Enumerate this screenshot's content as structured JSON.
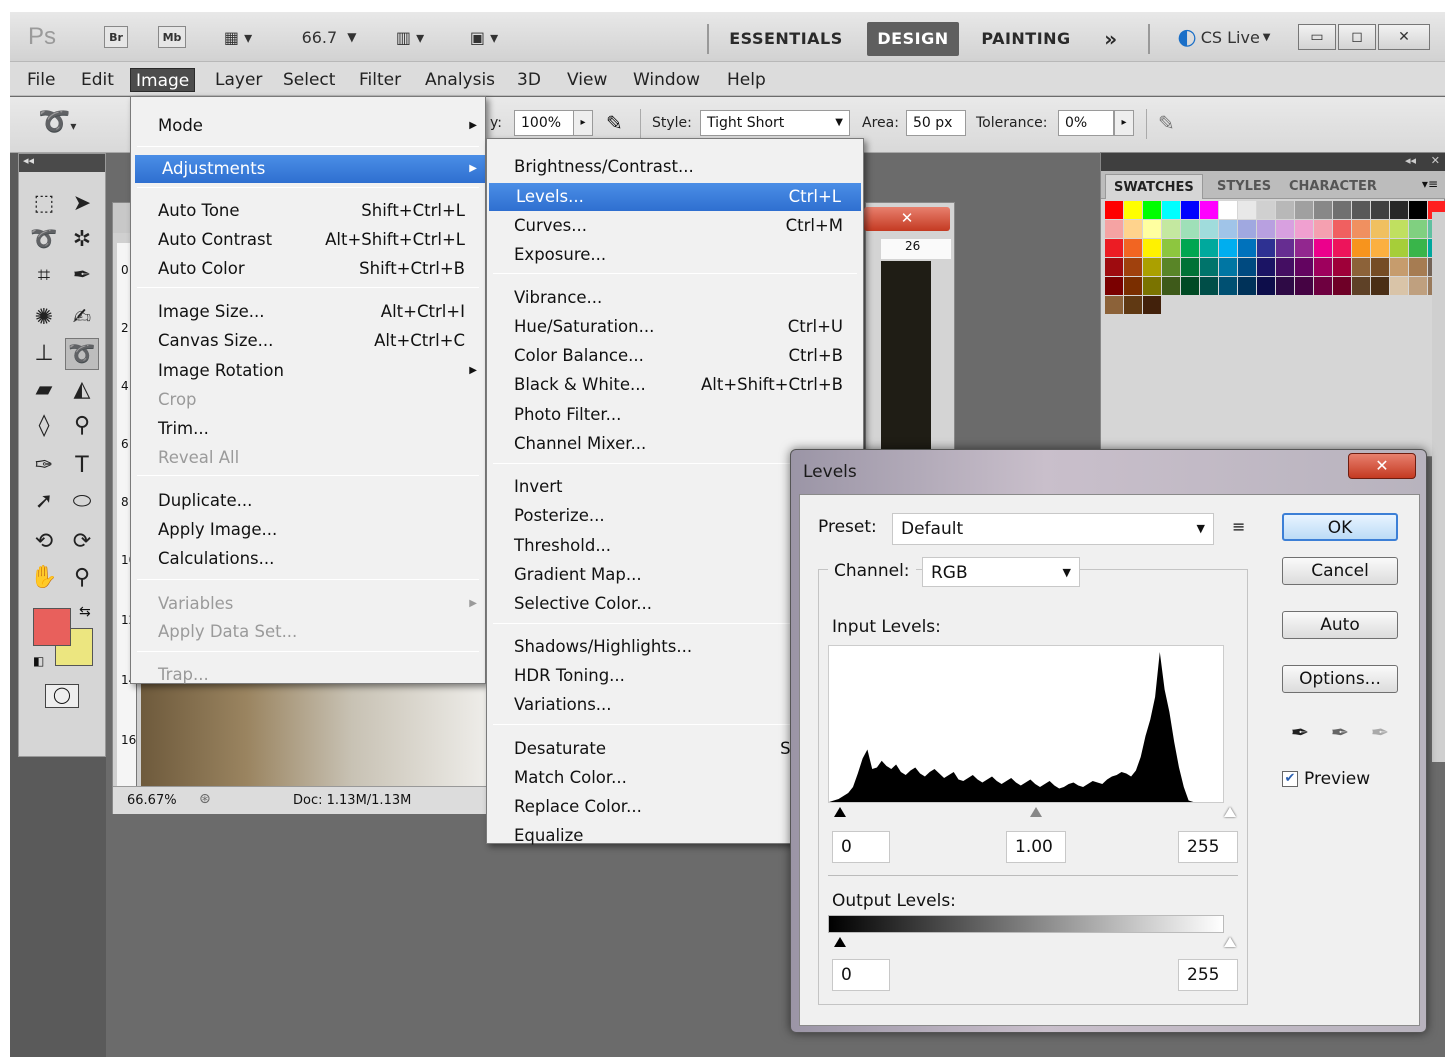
{
  "appbar": {
    "logo": "Ps",
    "bridge": "Br",
    "minibridge": "Mb",
    "zoom": "66.7",
    "workspaces": [
      "ESSENTIALS",
      "DESIGN",
      "PAINTING"
    ],
    "overflow": "»",
    "cslive": "CS Live"
  },
  "menubar": [
    "File",
    "Edit",
    "Image",
    "Layer",
    "Select",
    "Filter",
    "Analysis",
    "3D",
    "View",
    "Window",
    "Help"
  ],
  "options": {
    "opacity_suffix": "y:",
    "opacity_value": "100%",
    "style_label": "Style:",
    "style_value": "Tight Short",
    "area_label": "Area:",
    "area_value": "50 px",
    "tolerance_label": "Tolerance:",
    "tolerance_value": "0%"
  },
  "image_menu": [
    {
      "label": "Mode",
      "shortcut": "",
      "submenu": true,
      "disabled": false
    },
    {
      "label": "Adjustments",
      "shortcut": "",
      "submenu": true,
      "disabled": false
    },
    {
      "label": "Auto Tone",
      "shortcut": "Shift+Ctrl+L"
    },
    {
      "label": "Auto Contrast",
      "shortcut": "Alt+Shift+Ctrl+L"
    },
    {
      "label": "Auto Color",
      "shortcut": "Shift+Ctrl+B"
    },
    {
      "label": "Image Size...",
      "shortcut": "Alt+Ctrl+I"
    },
    {
      "label": "Canvas Size...",
      "shortcut": "Alt+Ctrl+C"
    },
    {
      "label": "Image Rotation",
      "shortcut": "",
      "submenu": true
    },
    {
      "label": "Crop",
      "shortcut": "",
      "disabled": true
    },
    {
      "label": "Trim...",
      "shortcut": ""
    },
    {
      "label": "Reveal All",
      "shortcut": "",
      "disabled": true
    },
    {
      "label": "Duplicate...",
      "shortcut": ""
    },
    {
      "label": "Apply Image...",
      "shortcut": ""
    },
    {
      "label": "Calculations...",
      "shortcut": ""
    },
    {
      "label": "Variables",
      "shortcut": "",
      "submenu": true,
      "disabled": true
    },
    {
      "label": "Apply Data Set...",
      "shortcut": "",
      "disabled": true
    },
    {
      "label": "Trap...",
      "shortcut": "",
      "disabled": true
    }
  ],
  "adjustments_menu": [
    {
      "label": "Brightness/Contrast...",
      "shortcut": ""
    },
    {
      "label": "Levels...",
      "shortcut": "Ctrl+L"
    },
    {
      "label": "Curves...",
      "shortcut": "Ctrl+M"
    },
    {
      "label": "Exposure...",
      "shortcut": ""
    },
    {
      "label": "Vibrance...",
      "shortcut": ""
    },
    {
      "label": "Hue/Saturation...",
      "shortcut": "Ctrl+U"
    },
    {
      "label": "Color Balance...",
      "shortcut": "Ctrl+B"
    },
    {
      "label": "Black & White...",
      "shortcut": "Alt+Shift+Ctrl+B"
    },
    {
      "label": "Photo Filter...",
      "shortcut": ""
    },
    {
      "label": "Channel Mixer...",
      "shortcut": ""
    },
    {
      "label": "Invert",
      "shortcut": ""
    },
    {
      "label": "Posterize...",
      "shortcut": ""
    },
    {
      "label": "Threshold...",
      "shortcut": ""
    },
    {
      "label": "Gradient Map...",
      "shortcut": ""
    },
    {
      "label": "Selective Color...",
      "shortcut": ""
    },
    {
      "label": "Shadows/Highlights...",
      "shortcut": ""
    },
    {
      "label": "HDR Toning...",
      "shortcut": ""
    },
    {
      "label": "Variations...",
      "shortcut": ""
    },
    {
      "label": "Desaturate",
      "shortcut": "Shift+C"
    },
    {
      "label": "Match Color...",
      "shortcut": ""
    },
    {
      "label": "Replace Color...",
      "shortcut": ""
    },
    {
      "label": "Equalize",
      "shortcut": ""
    }
  ],
  "document": {
    "zoom": "66.67%",
    "doc_info": "Doc: 1.13M/1.13M",
    "ruler_marks": [
      "0",
      "2",
      "4",
      "6",
      "8",
      "10",
      "12",
      "14",
      "16"
    ],
    "ruler2": "26"
  },
  "swatches": {
    "tabs": [
      "SWATCHES",
      "STYLES",
      "CHARACTER"
    ],
    "colors": [
      "#ff0000",
      "#ffff00",
      "#00ff00",
      "#00ffff",
      "#0000ff",
      "#ff00ff",
      "#ffffff",
      "#e8e8e8",
      "#d0d0d0",
      "#b8b8b8",
      "#a0a0a0",
      "#888888",
      "#707070",
      "#585858",
      "#404040",
      "#282828",
      "#000000",
      "#ff2020",
      "#f5a3a3",
      "#ffd38d",
      "#ffffa0",
      "#c4e8a0",
      "#9fe0b8",
      "#a0dcdc",
      "#a0c4e8",
      "#a0a8e0",
      "#b8a0e0",
      "#d8a0e0",
      "#f0a0d0",
      "#f5a0b0",
      "#f06060",
      "#f09060",
      "#f0c060",
      "#c0e060",
      "#80d080",
      "#60c0a0",
      "#ec1c24",
      "#f26522",
      "#fff200",
      "#8dc63f",
      "#00a651",
      "#00a99d",
      "#00aeef",
      "#0072bc",
      "#2e3192",
      "#662d91",
      "#92278f",
      "#ec008c",
      "#ed145b",
      "#f7941d",
      "#fbb040",
      "#a6ce39",
      "#39b54a",
      "#00a79d",
      "#9e0b0f",
      "#a0410d",
      "#aba000",
      "#598527",
      "#007236",
      "#00746b",
      "#0076a3",
      "#004a80",
      "#1b1464",
      "#440e62",
      "#630460",
      "#9e005d",
      "#9e0039",
      "#8c6239",
      "#754c24",
      "#c69c6d",
      "#a67c52",
      "#736357",
      "#7a0000",
      "#7a2e00",
      "#7a7300",
      "#3e5a1a",
      "#004a24",
      "#004e48",
      "#005072",
      "#003259",
      "#0d0d4a",
      "#2e0a45",
      "#450343",
      "#6e0040",
      "#6e0027",
      "#5e4127",
      "#4a2f16",
      "#d9c4a8",
      "#bfa07f",
      "#997a5c",
      "#8c6239",
      "#603913",
      "#42210b"
    ]
  },
  "levels": {
    "title": "Levels",
    "preset_label": "Preset:",
    "preset_value": "Default",
    "channel_label": "Channel:",
    "channel_value": "RGB",
    "input_label": "Input Levels:",
    "input_black": "0",
    "input_mid": "1.00",
    "input_white": "255",
    "output_label": "Output Levels:",
    "output_black": "0",
    "output_white": "255",
    "buttons": {
      "ok": "OK",
      "cancel": "Cancel",
      "auto": "Auto",
      "options": "Options..."
    },
    "preview_label": "Preview",
    "preview_checked": true,
    "histogram": [
      0,
      2,
      4,
      8,
      12,
      20,
      38,
      58,
      70,
      44,
      46,
      55,
      48,
      44,
      50,
      40,
      36,
      42,
      46,
      38,
      34,
      40,
      44,
      38,
      32,
      36,
      40,
      30,
      28,
      32,
      36,
      30,
      26,
      30,
      34,
      28,
      24,
      28,
      32,
      26,
      22,
      26,
      30,
      24,
      20,
      24,
      28,
      22,
      18,
      20,
      24,
      26,
      22,
      20,
      24,
      28,
      26,
      24,
      30,
      34,
      36,
      40,
      38,
      34,
      42,
      60,
      88,
      110,
      140,
      200,
      150,
      120,
      80,
      46,
      20,
      2,
      0,
      0,
      0
    ]
  }
}
